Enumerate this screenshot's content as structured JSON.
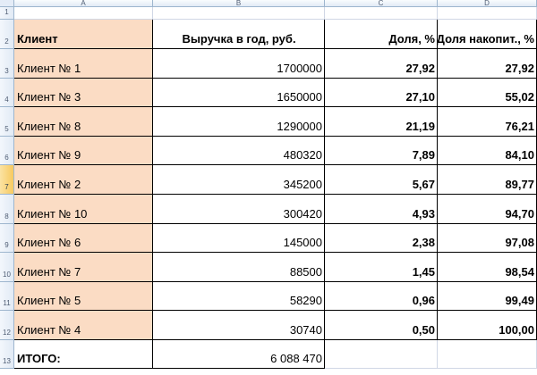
{
  "columns": [
    "A",
    "B",
    "C",
    "D"
  ],
  "row_numbers": [
    "1",
    "2",
    "3",
    "4",
    "5",
    "6",
    "7",
    "8",
    "9",
    "10",
    "11",
    "12",
    "13"
  ],
  "selected_row": "7",
  "header": {
    "client": "Клиент",
    "revenue": "Выручка в год, руб.",
    "share": "Доля, %",
    "cumulative": "Доля накопит., %"
  },
  "rows": [
    {
      "client": "Клиент № 1",
      "revenue": "1700000",
      "share": "27,92",
      "cumulative": "27,92"
    },
    {
      "client": "Клиент № 3",
      "revenue": "1650000",
      "share": "27,10",
      "cumulative": "55,02"
    },
    {
      "client": "Клиент № 8",
      "revenue": "1290000",
      "share": "21,19",
      "cumulative": "76,21"
    },
    {
      "client": "Клиент № 9",
      "revenue": "480320",
      "share": "7,89",
      "cumulative": "84,10"
    },
    {
      "client": "Клиент № 2",
      "revenue": "345200",
      "share": "5,67",
      "cumulative": "89,77"
    },
    {
      "client": "Клиент № 10",
      "revenue": "300420",
      "share": "4,93",
      "cumulative": "94,70"
    },
    {
      "client": "Клиент № 6",
      "revenue": "145000",
      "share": "2,38",
      "cumulative": "97,08"
    },
    {
      "client": "Клиент № 7",
      "revenue": "88500",
      "share": "1,45",
      "cumulative": "98,54"
    },
    {
      "client": "Клиент № 5",
      "revenue": "58290",
      "share": "0,96",
      "cumulative": "99,49"
    },
    {
      "client": "Клиент № 4",
      "revenue": "30740",
      "share": "0,50",
      "cumulative": "100,00"
    }
  ],
  "total": {
    "label": "ИТОГО:",
    "revenue": "6 088 470"
  },
  "colors": {
    "client_fill": "#fbdcc4",
    "header_bg": "#e1eaf5",
    "selected_row_header": "#f7c95f"
  }
}
